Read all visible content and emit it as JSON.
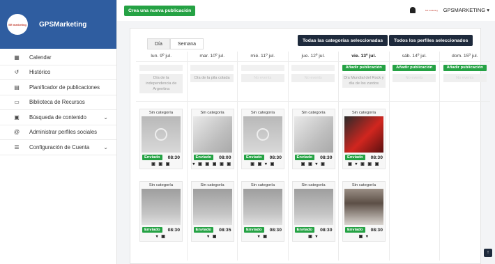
{
  "brand": {
    "logo_text": "SR marketing",
    "title": "GPSMarketing"
  },
  "sidebar": {
    "items": [
      {
        "icon": "calendar-icon",
        "glyph": "▦",
        "label": "Calendar",
        "chevron": false
      },
      {
        "icon": "history-icon",
        "glyph": "↺",
        "label": "Histórico",
        "chevron": false
      },
      {
        "icon": "planner-icon",
        "glyph": "▤",
        "label": "Planificador de publicaciones",
        "chevron": false
      },
      {
        "icon": "library-icon",
        "glyph": "▭",
        "label": "Biblioteca de Recursos",
        "chevron": false
      },
      {
        "icon": "search-content-icon",
        "glyph": "▣",
        "label": "Búsqueda de contenido",
        "chevron": true
      },
      {
        "icon": "at-icon",
        "glyph": "@",
        "label": "Administrar perfiles sociales",
        "chevron": false
      },
      {
        "icon": "settings-icon",
        "glyph": "☰",
        "label": "Configuración de Cuenta",
        "chevron": true
      }
    ]
  },
  "topbar": {
    "new_post_label": "Crea una nueva publicación",
    "account_label": "GPSMARKETING ▾"
  },
  "panel": {
    "tab_day": "Día",
    "tab_week": "Semana",
    "all_categories": "Todas las categorías seleccionadas",
    "all_profiles": "Todos los perfiles seleccionados",
    "scroll_top": "↑"
  },
  "days": [
    {
      "label": "lun. 9º jul.",
      "bold": false,
      "add": "",
      "add_active": false,
      "holiday": "Día de la independencia de Argentina",
      "holiday_empty": false,
      "posts": [
        {
          "category": "Sin categoría",
          "status": "Enviado",
          "time": "08:30",
          "networks": "▣ ▣ ▣",
          "thumb": "grey1"
        },
        {
          "category": "Sin categoría",
          "status": "Enviado",
          "time": "08:30",
          "networks": "▾ ▣",
          "thumb": "grey3"
        }
      ]
    },
    {
      "label": "mar. 10º jul.",
      "bold": false,
      "add": "",
      "add_active": false,
      "holiday": "Día de la pila colada",
      "holiday_empty": false,
      "posts": [
        {
          "category": "Sin categoría",
          "status": "Enviado",
          "time": "08:00",
          "networks": "▾ ▣ ▣ ▣ ▣ ▣",
          "thumb": "grey2"
        },
        {
          "category": "Sin categoría",
          "status": "Enviado",
          "time": "08:35",
          "networks": "▾ ▣",
          "thumb": "grey3"
        }
      ]
    },
    {
      "label": "mié. 11º jul.",
      "bold": false,
      "add": "",
      "add_active": false,
      "holiday": "No events",
      "holiday_empty": true,
      "posts": [
        {
          "category": "Sin categoría",
          "status": "Enviado",
          "time": "08:30",
          "networks": "▣ ▣ ▾ ▣",
          "thumb": "grey1"
        },
        {
          "category": "Sin categoría",
          "status": "Enviado",
          "time": "08:30",
          "networks": "▾ ▣",
          "thumb": "grey3"
        }
      ]
    },
    {
      "label": "jue. 12º jul.",
      "bold": false,
      "add": "",
      "add_active": false,
      "holiday": "No events",
      "holiday_empty": true,
      "posts": [
        {
          "category": "Sin categoría",
          "status": "Enviado",
          "time": "08:30",
          "networks": "▣ ▣ ▾ ▣",
          "thumb": "grey2"
        },
        {
          "category": "Sin categoría",
          "status": "Enviado",
          "time": "08:30",
          "networks": "▣ ▾",
          "thumb": "grey3"
        }
      ]
    },
    {
      "label": "vie. 13º jul.",
      "bold": true,
      "add": "Añadir publicación",
      "add_active": true,
      "holiday": "Día Mundial del Rock y día de los zurdos",
      "holiday_empty": false,
      "posts": [
        {
          "category": "Sin categoría",
          "status": "Enviado",
          "time": "08:30",
          "networks": "▣ ▾ ▣ ▣ ▣",
          "thumb": "dark"
        },
        {
          "category": "Sin categoría",
          "status": "Enviado",
          "time": "08:30",
          "networks": "▣ ▾",
          "thumb": "room"
        }
      ]
    },
    {
      "label": "sáb. 14º jul.",
      "bold": false,
      "add": "Añadir publicación",
      "add_active": true,
      "holiday": "No events",
      "holiday_empty": true,
      "posts": []
    },
    {
      "label": "dom. 15º jul.",
      "bold": false,
      "add": "Añadir publicación",
      "add_active": true,
      "holiday": "No events",
      "holiday_empty": true,
      "posts": []
    }
  ]
}
